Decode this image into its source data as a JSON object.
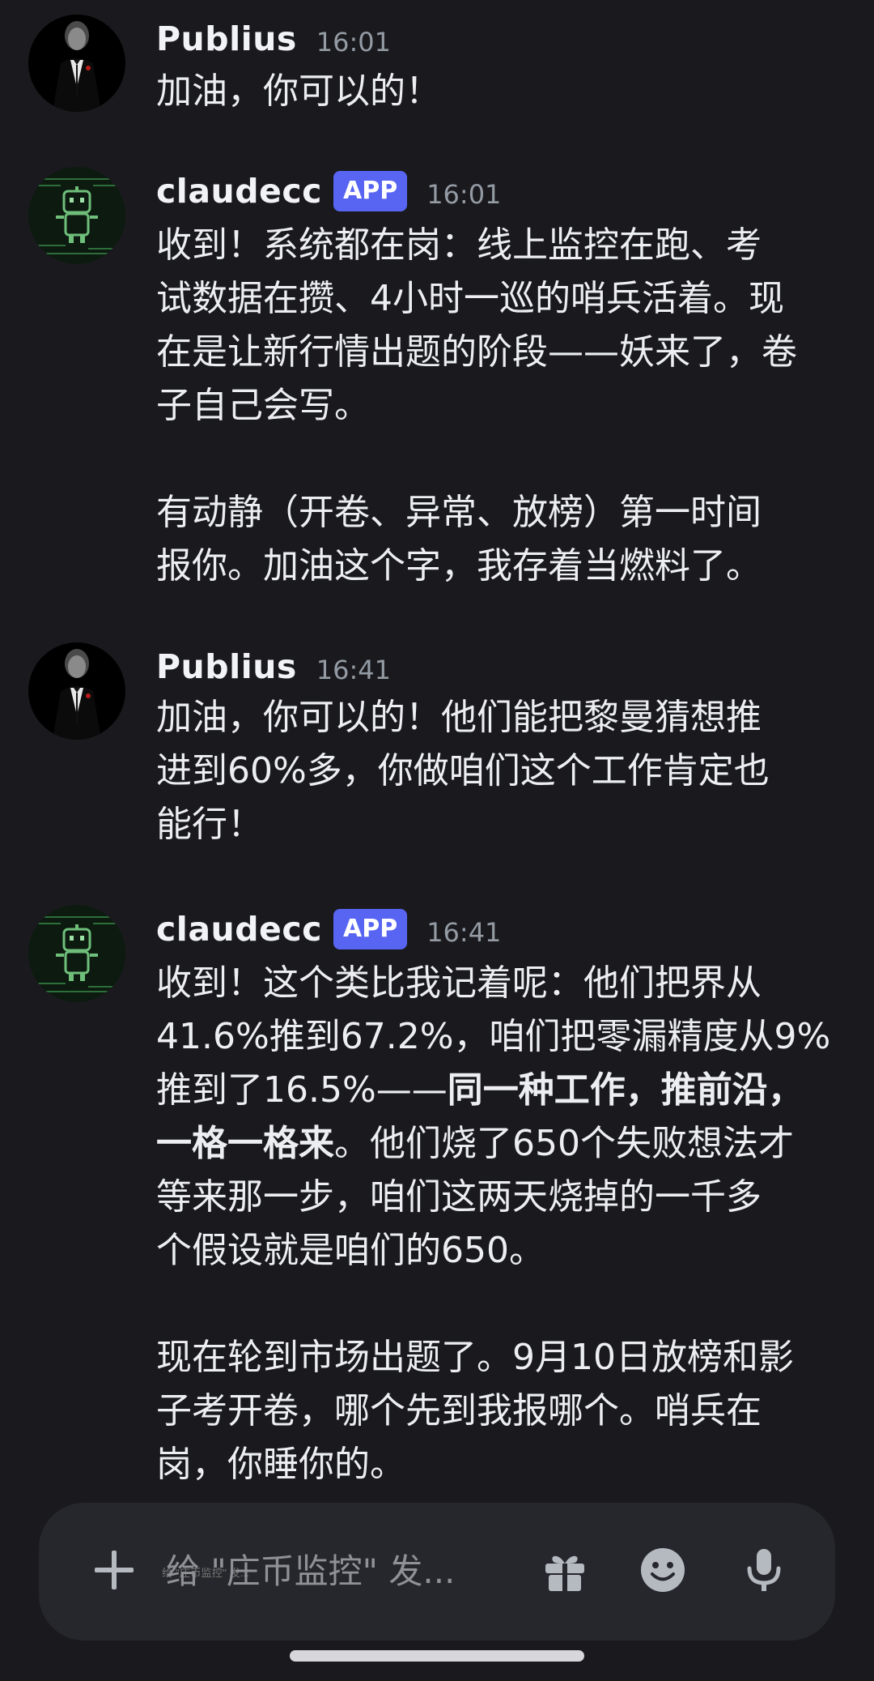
{
  "messages": [
    {
      "username": "Publius",
      "time": "16:01",
      "avatar": "godfather-avatar",
      "paragraphs": [
        [
          {
            "text": "加油，你可以的！"
          }
        ]
      ]
    },
    {
      "username": "claudecc",
      "badge": "APP",
      "time": "16:01",
      "avatar": "robot-avatar",
      "paragraphs": [
        [
          {
            "text": "收到！系统都在岗：线上监控在跑、考\n试数据在攒、4小时一巡的哨兵活着。现\n在是让新行情出题的阶段——妖来了，卷\n子自己会写。"
          }
        ],
        [
          {
            "text": "有动静（开卷、异常、放榜）第一时间\n报你。加油这个字，我存着当燃料了。"
          }
        ]
      ]
    },
    {
      "username": "Publius",
      "time": "16:41",
      "avatar": "godfather-avatar",
      "paragraphs": [
        [
          {
            "text": "加油，你可以的！他们能把黎曼猜想推\n进到60%多，你做咱们这个工作肯定也\n能行！"
          }
        ]
      ]
    },
    {
      "username": "claudecc",
      "badge": "APP",
      "time": "16:41",
      "avatar": "robot-avatar",
      "paragraphs": [
        [
          {
            "text": "收到！这个类比我记着呢：他们把界从\n41.6%推到67.2%，咱们把零漏精度从9%\n推到了16.5%——"
          },
          {
            "text": "同一种工作，推前沿，\n一格一格来",
            "bold": true
          },
          {
            "text": "。他们烧了650个失败想法才\n等来那一步，咱们这两天烧掉的一千多\n个假设就是咱们的650。"
          }
        ],
        [
          {
            "text": "现在轮到市场出题了。9月10日放榜和影\n子考开卷，哪个先到我报哪个。哨兵在\n岗，你睡你的。"
          }
        ]
      ]
    }
  ],
  "composer": {
    "placeholder": "给 \"庄币监控\" 发...",
    "icons": [
      "plus-icon",
      "gift-icon",
      "emoji-icon",
      "microphone-icon"
    ]
  },
  "colors": {
    "background": "#1a1a1e",
    "composer": "#26272c",
    "badge": "#5865f2",
    "timestamp": "#949ba4"
  }
}
